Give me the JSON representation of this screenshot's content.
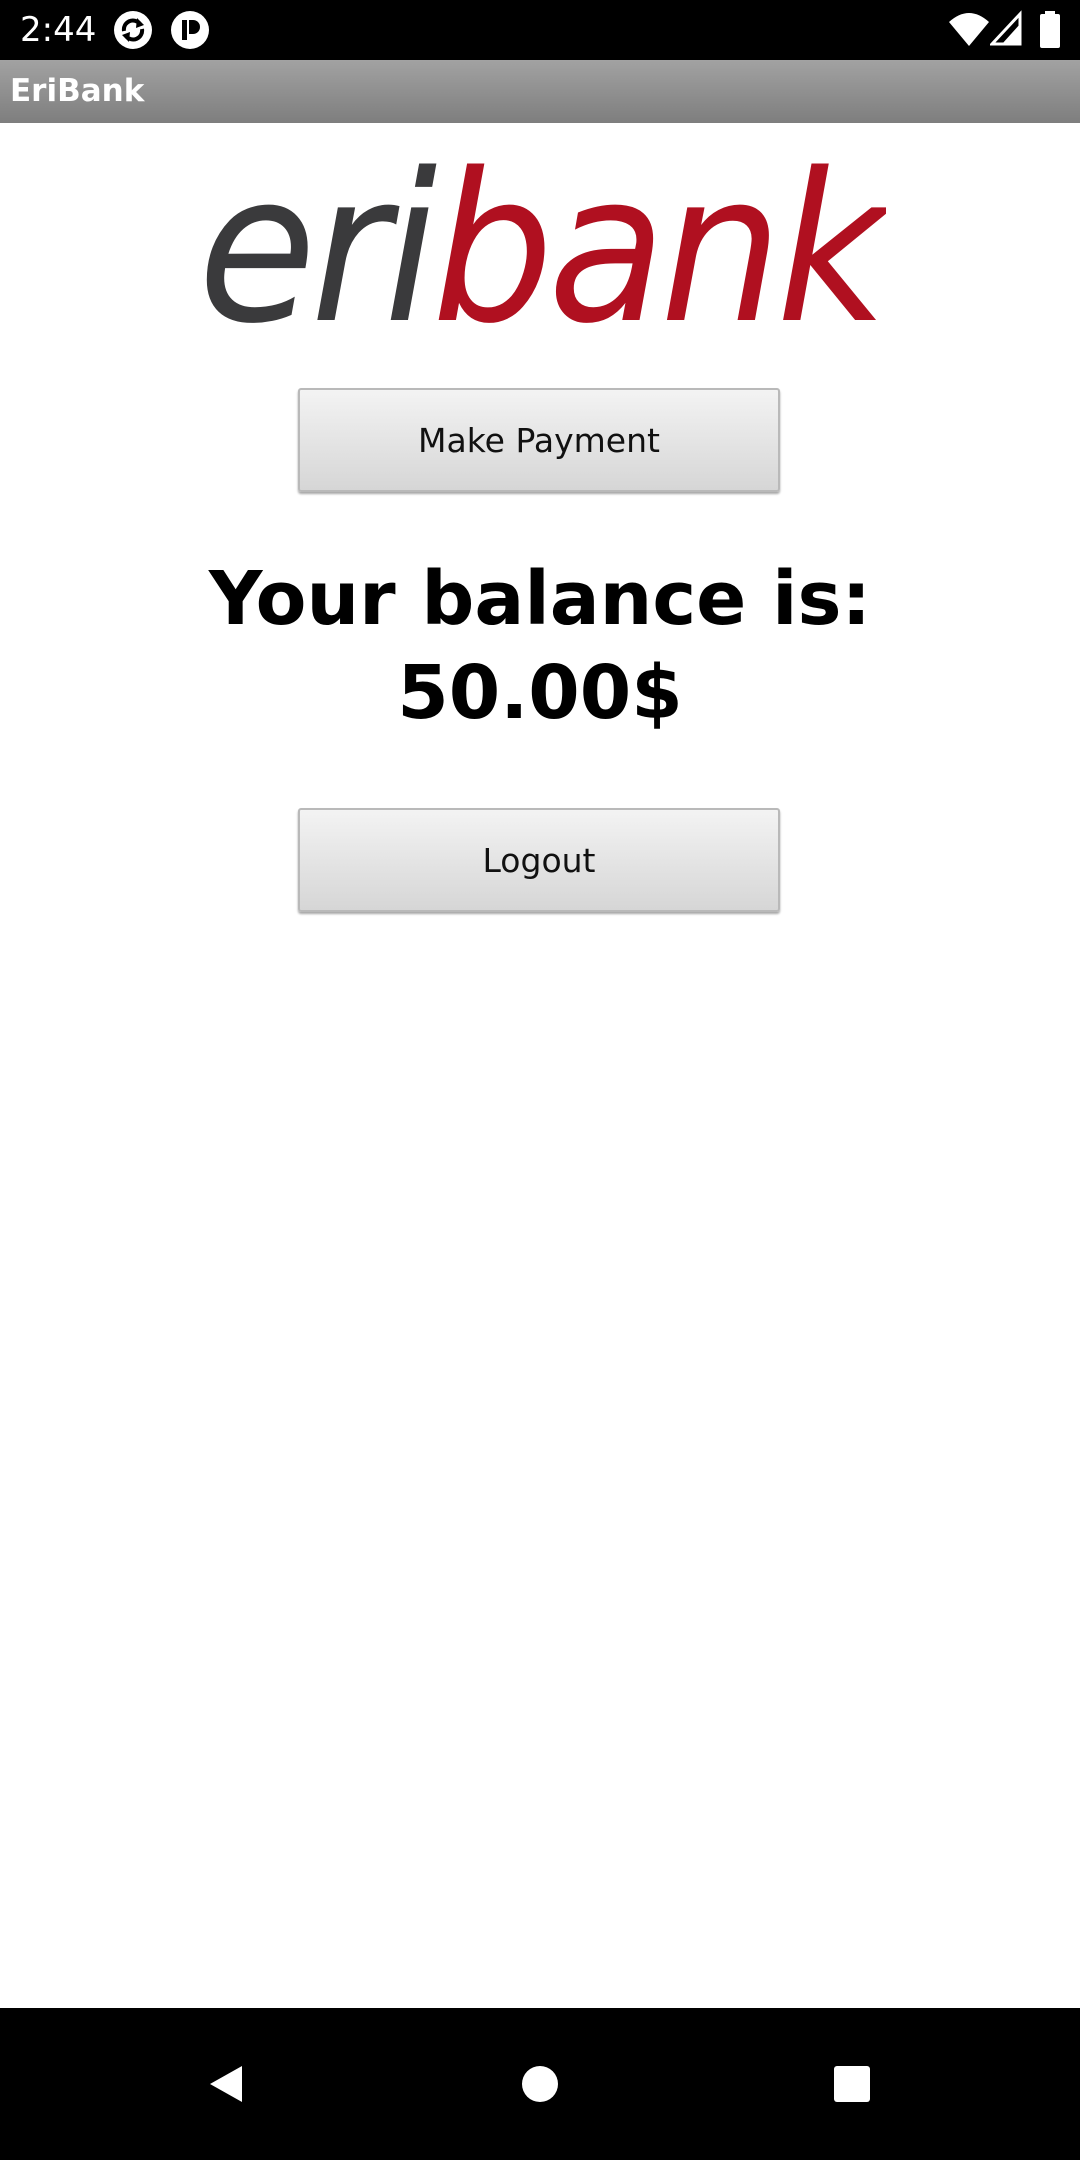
{
  "status_bar": {
    "time": "2:44",
    "left_icons": [
      "sync-icon",
      "notification-app-icon"
    ],
    "right_icons": [
      "wifi-icon",
      "cellular-signal-icon",
      "battery-icon"
    ]
  },
  "action_bar": {
    "title": "EriBank"
  },
  "logo": {
    "text_part1": "eri",
    "text_part2": "bank",
    "color_part1": "#3a3a3c",
    "color_part2": "#b01020"
  },
  "main": {
    "make_payment_label": "Make Payment",
    "balance_text": "Your balance is:\n50.00$",
    "logout_label": "Logout"
  },
  "nav_bar": {
    "buttons": [
      "back-icon",
      "home-icon",
      "recents-icon"
    ]
  },
  "colors": {
    "action_bar": "#8f8f8f",
    "button_bg": "#e3e3e3",
    "system_bars": "#000000"
  }
}
